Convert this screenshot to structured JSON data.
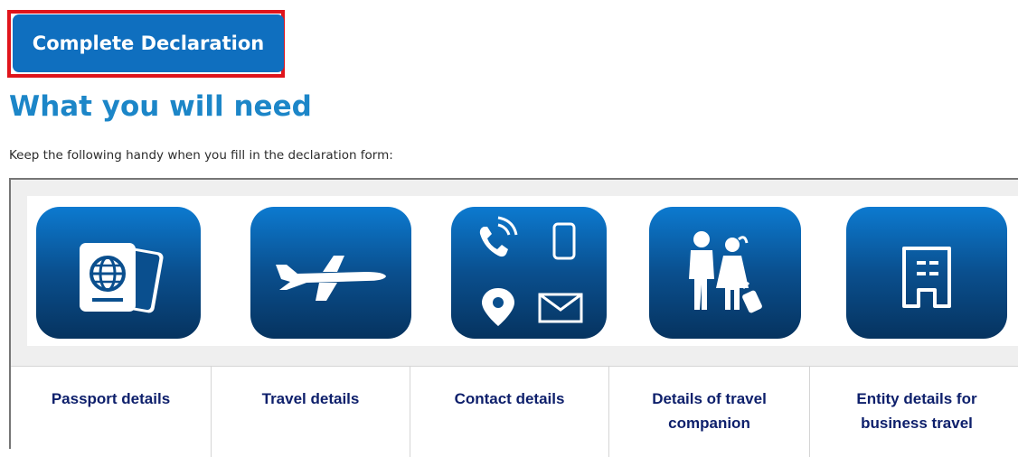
{
  "action": {
    "button_label": "Complete Declaration"
  },
  "section": {
    "heading": "What you will need",
    "intro": "Keep the following handy when you fill in the declaration form:"
  },
  "requirements": [
    {
      "label_line1": "Passport details",
      "label_line2": "",
      "icon": "passport-icon"
    },
    {
      "label_line1": "Travel details",
      "label_line2": "",
      "icon": "airplane-icon"
    },
    {
      "label_line1": "Contact details",
      "label_line2": "",
      "icon": "contact-icons"
    },
    {
      "label_line1": "Details of travel",
      "label_line2": "companion",
      "icon": "travel-companion-icon"
    },
    {
      "label_line1": "Entity details for",
      "label_line2": "business travel",
      "icon": "building-icon"
    }
  ],
  "colors": {
    "primary": "#0f6fbf",
    "heading": "#1c86c8",
    "label": "#0d1f6b",
    "highlight": "#e0141b"
  }
}
